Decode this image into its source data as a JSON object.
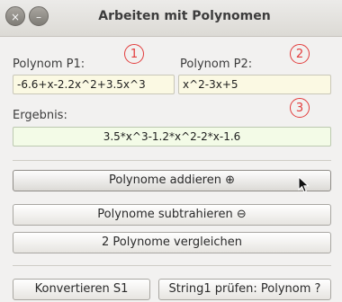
{
  "window": {
    "title": "Arbeiten mit Polynomen",
    "close_glyph": "×",
    "min_glyph": "–"
  },
  "markers": [
    "1",
    "2",
    "3"
  ],
  "p1": {
    "label": "Polynom P1:",
    "value": "-6.6+x-2.2x^2+3.5x^3"
  },
  "p2": {
    "label": "Polynom P2:",
    "value": "x^2-3x+5"
  },
  "result": {
    "label": "Ergebnis:",
    "value": "3.5*x^3-1.2*x^2-2*x-1.6"
  },
  "buttons": {
    "add": "Polynome addieren ⊕",
    "subtract": "Polynome subtrahieren ⊖",
    "compare": "2 Polynome vergleichen",
    "convert": "Konvertieren S1",
    "check": "String1 prüfen: Polynom ?"
  },
  "colors": {
    "marker": "#e23b3b",
    "input_bg": "#fbf9e3",
    "result_bg": "#f3fbe7"
  }
}
